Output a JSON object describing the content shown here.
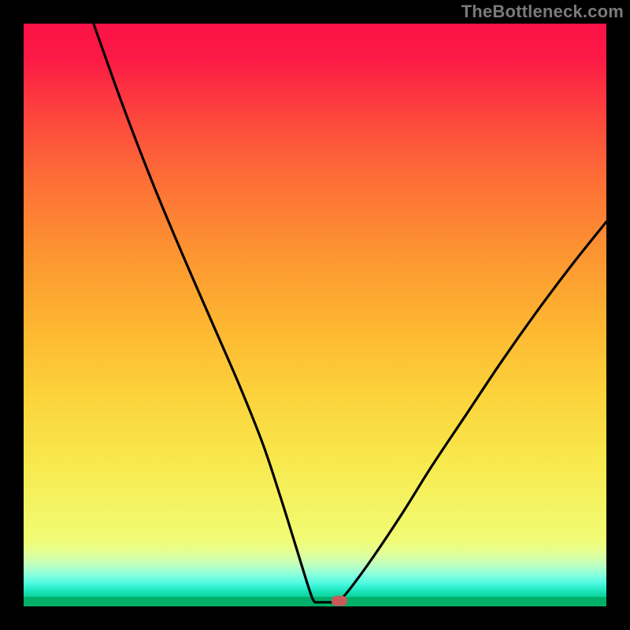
{
  "watermark": "TheBottleneck.com",
  "colors": {
    "frame_bg": "#000000",
    "watermark": "#7a7a7a",
    "curve": "#000000",
    "marker": "#c85a5a",
    "gradient_top": "#fb1246",
    "gradient_bottom": "#00b068"
  },
  "chart_data": {
    "type": "line",
    "title": "",
    "xlabel": "",
    "ylabel": "",
    "xlim": [
      0,
      100
    ],
    "ylim": [
      0,
      100
    ],
    "background_gradient": {
      "direction": "vertical",
      "stops": [
        {
          "pos": 0.0,
          "color": "#fb1246"
        },
        {
          "pos": 0.5,
          "color": "#fdb431"
        },
        {
          "pos": 0.88,
          "color": "#f1fb75"
        },
        {
          "pos": 1.0,
          "color": "#00b068"
        }
      ]
    },
    "series": [
      {
        "name": "bottleneck-curve",
        "segments": [
          {
            "name": "left",
            "points": [
              {
                "x": 12.0,
                "y": 100.0
              },
              {
                "x": 17.0,
                "y": 86.0
              },
              {
                "x": 22.0,
                "y": 73.0
              },
              {
                "x": 27.0,
                "y": 61.0
              },
              {
                "x": 32.0,
                "y": 49.5
              },
              {
                "x": 37.0,
                "y": 38.0
              },
              {
                "x": 41.0,
                "y": 28.0
              },
              {
                "x": 44.0,
                "y": 19.0
              },
              {
                "x": 46.5,
                "y": 11.0
              },
              {
                "x": 48.5,
                "y": 4.5
              },
              {
                "x": 49.5,
                "y": 1.5
              },
              {
                "x": 50.0,
                "y": 0.7
              }
            ]
          },
          {
            "name": "flat-bottom",
            "points": [
              {
                "x": 50.0,
                "y": 0.7
              },
              {
                "x": 54.0,
                "y": 0.7
              }
            ]
          },
          {
            "name": "right",
            "points": [
              {
                "x": 54.0,
                "y": 0.7
              },
              {
                "x": 56.0,
                "y": 3.0
              },
              {
                "x": 60.0,
                "y": 8.5
              },
              {
                "x": 65.0,
                "y": 16.0
              },
              {
                "x": 70.0,
                "y": 24.0
              },
              {
                "x": 76.0,
                "y": 33.0
              },
              {
                "x": 82.0,
                "y": 42.0
              },
              {
                "x": 88.0,
                "y": 50.5
              },
              {
                "x": 94.0,
                "y": 58.5
              },
              {
                "x": 100.0,
                "y": 66.0
              }
            ]
          }
        ]
      }
    ],
    "marker": {
      "x": 54.2,
      "y": 1.0
    }
  }
}
